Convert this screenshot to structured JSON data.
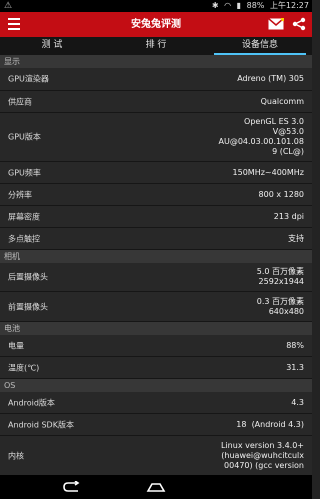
{
  "status_bar": {
    "battery": "88%",
    "time": "上午12:27"
  },
  "app_title": "安兔兔评测",
  "tabs": [
    "测 试",
    "排 行",
    "设备信息"
  ],
  "sections": [
    {
      "title": "显示",
      "rows": [
        {
          "label": "GPU渲染器",
          "value": "Adreno (TM) 305",
          "h": 22
        },
        {
          "label": "供应商",
          "value": "Qualcomm",
          "h": 21
        },
        {
          "label": "GPU版本",
          "value": "OpenGL ES 3.0\nV@53.0\nAU@04.03.00.101.08\n9 (CL@)",
          "h": 48
        },
        {
          "label": "GPU频率",
          "value": "150MHz~400MHz",
          "h": 21
        },
        {
          "label": "分辨率",
          "value": "800 x 1280",
          "h": 21
        },
        {
          "label": "屏幕密度",
          "value": "213 dpi",
          "h": 21
        },
        {
          "label": "多点触控",
          "value": "支持",
          "h": 21
        }
      ]
    },
    {
      "title": "相机",
      "rows": [
        {
          "label": "后置摄像头",
          "value": "5.0 百万像素\n2592x1944",
          "h": 28
        },
        {
          "label": "前置摄像头",
          "value": "0.3 百万像素\n640x480",
          "h": 29
        }
      ]
    },
    {
      "title": "电池",
      "rows": [
        {
          "label": "电量",
          "value": "88%",
          "h": 21
        },
        {
          "label": "温度(℃)",
          "value": "31.3",
          "h": 21
        }
      ]
    },
    {
      "title": "OS",
      "rows": [
        {
          "label": "Android版本",
          "value": "4.3",
          "h": 21
        },
        {
          "label": "Android SDK版本",
          "value": "18  (Android 4.3)",
          "h": 21
        },
        {
          "label": "内核",
          "value": "Linux version 3.4.0+\n(huawei@wuhcitculx\n00470) (gcc version",
          "h": 40
        }
      ]
    }
  ]
}
